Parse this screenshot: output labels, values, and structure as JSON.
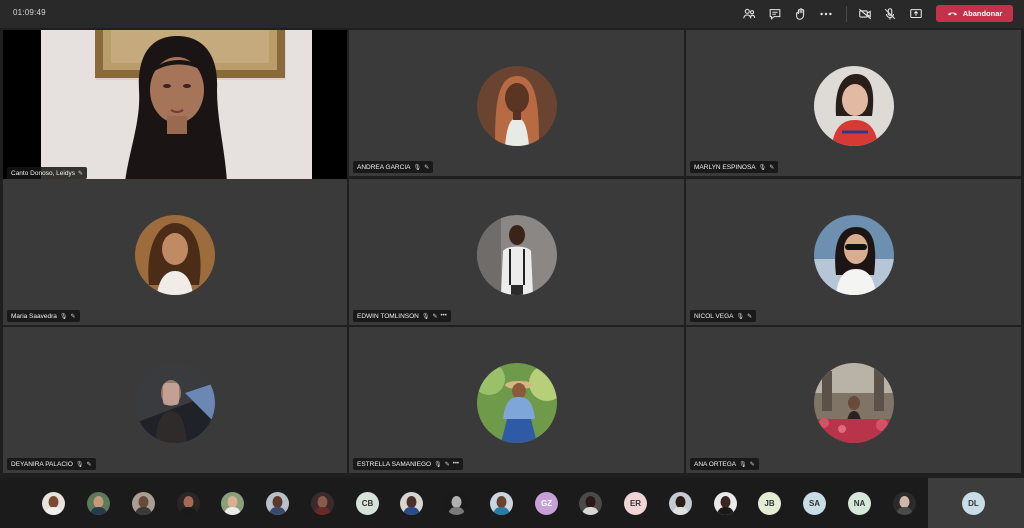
{
  "meeting": {
    "timer": "01:09:49",
    "leave_label": "Abandonar",
    "toolbar_icons": [
      "participants-icon",
      "chat-icon",
      "raise-hand-icon",
      "more-icon",
      "camera-off-icon",
      "mic-off-icon",
      "share-icon"
    ]
  },
  "featured": {
    "name": "Canto Donoso, Leidys"
  },
  "tiles": [
    {
      "name": "ANDREA GARCIA"
    },
    {
      "name": "MARLYN ESPINOSA"
    },
    {
      "name": "Maria Saavedra"
    },
    {
      "name": "EDWIN TOMLINSON",
      "more": "•••"
    },
    {
      "name": "NICOL VEGA"
    },
    {
      "name": "DEYANIRA PALACIO"
    },
    {
      "name": "ESTRELLA SAMANIEGO",
      "more": "•••"
    },
    {
      "name": "ANA ORTEGA"
    }
  ],
  "strip": {
    "initials": [
      "CB",
      "GZ",
      "ER",
      "JB",
      "SA",
      "NA"
    ],
    "self_initials": "DL"
  },
  "colors": {
    "leave": "#c4314b",
    "tile": "#3a3a3a",
    "background": "#1f1f1f"
  }
}
